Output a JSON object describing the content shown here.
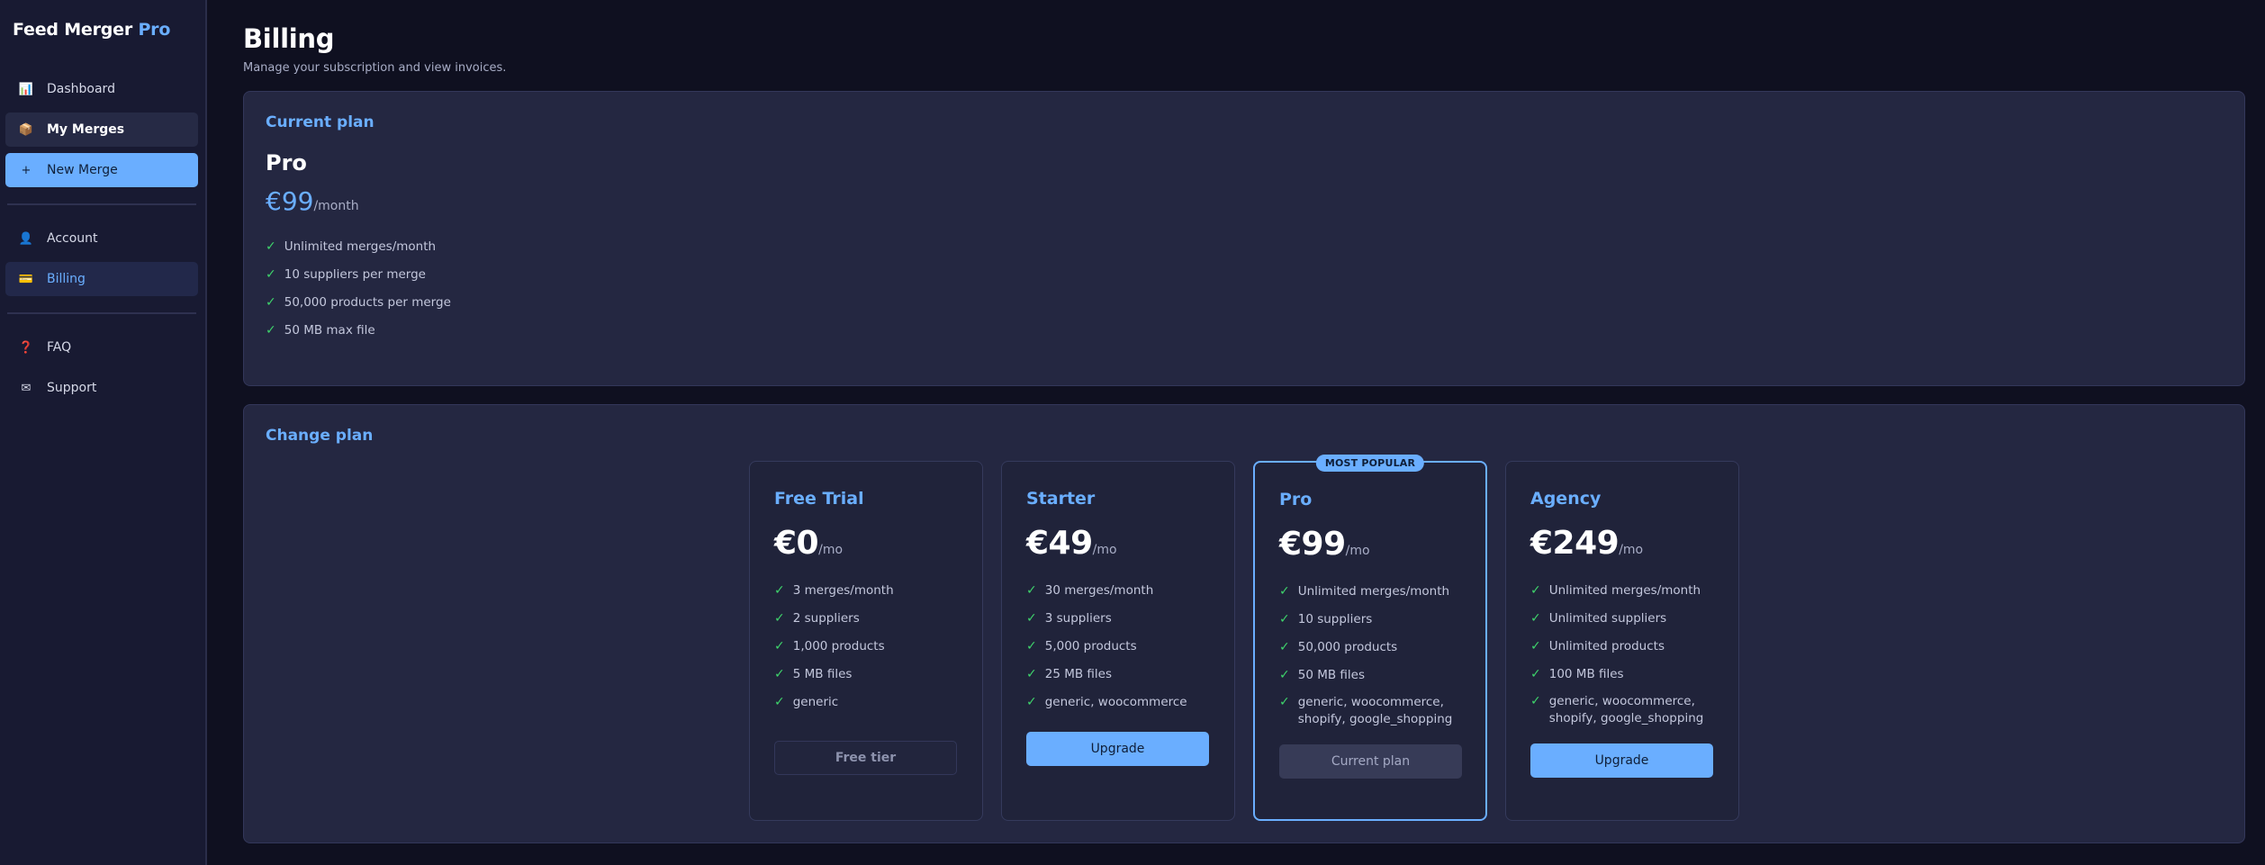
{
  "sidebar": {
    "brand": "Feed Merger",
    "brand_accent": "Pro",
    "items": [
      {
        "icon": "chart-icon",
        "glyph": "📊",
        "label": "Dashboard"
      },
      {
        "icon": "package-icon",
        "glyph": "📦",
        "label": "My Merges"
      },
      {
        "icon": "plus-icon",
        "glyph": "+",
        "label": "New Merge"
      },
      {
        "icon": "user-icon",
        "glyph": "👤",
        "label": "Account"
      },
      {
        "icon": "card-icon",
        "glyph": "💳",
        "label": "Billing"
      },
      {
        "icon": "question-icon",
        "glyph": "❓",
        "label": "FAQ"
      },
      {
        "icon": "mail-icon",
        "glyph": "✉",
        "label": "Support"
      }
    ]
  },
  "header": {
    "title": "Billing",
    "subtitle": "Manage your subscription and view invoices."
  },
  "current_plan": {
    "heading": "Current plan",
    "name": "Pro",
    "price": "€99",
    "period": "/month",
    "features": [
      "Unlimited merges/month",
      "10 suppliers per merge",
      "50,000 products per merge",
      "50 MB max file"
    ]
  },
  "change_plan": {
    "heading": "Change plan",
    "plans": [
      {
        "name": "Free Trial",
        "price": "€0",
        "period": "/mo",
        "features": [
          "3 merges/month",
          "2 suppliers",
          "1,000 products",
          "5 MB files",
          "generic"
        ],
        "button": "Free tier"
      },
      {
        "name": "Starter",
        "price": "€49",
        "period": "/mo",
        "features": [
          "30 merges/month",
          "3 suppliers",
          "5,000 products",
          "25 MB files",
          "generic, woocommerce"
        ],
        "button": "Upgrade"
      },
      {
        "name": "Pro",
        "price": "€99",
        "period": "/mo",
        "badge": "MOST POPULAR",
        "features": [
          "Unlimited merges/month",
          "10 suppliers",
          "50,000 products",
          "50 MB files",
          "generic, woocommerce, shopify, google_shopping"
        ],
        "button": "Current plan"
      },
      {
        "name": "Agency",
        "price": "€249",
        "period": "/mo",
        "features": [
          "Unlimited merges/month",
          "Unlimited suppliers",
          "Unlimited products",
          "100 MB files",
          "generic, woocommerce, shopify, google_shopping"
        ],
        "button": "Upgrade"
      }
    ]
  },
  "colors": {
    "accent": "#6aaeff",
    "check": "#3ed26b",
    "background": "#0f1020",
    "panel": "#242741"
  }
}
